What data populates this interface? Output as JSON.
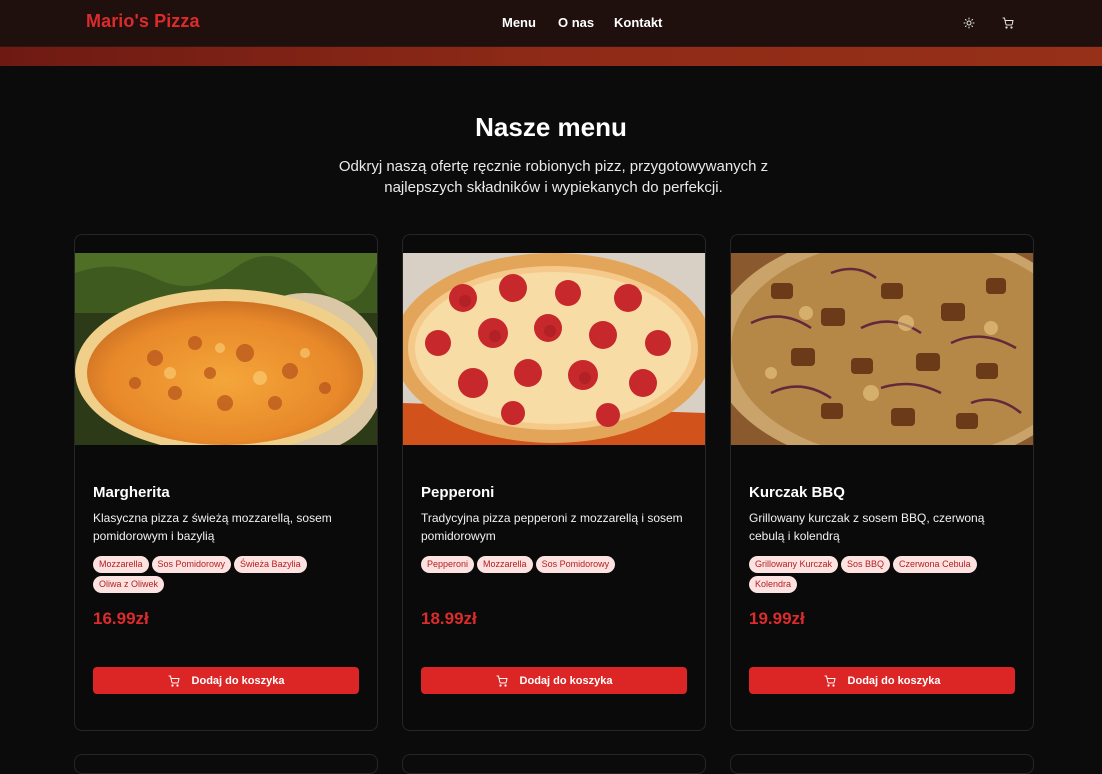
{
  "nav": {
    "brand": "Mario's Pizza",
    "links": [
      "Menu",
      "O nas",
      "Kontakt"
    ],
    "theme_icon": "sun-icon",
    "cart_icon": "cart-icon"
  },
  "hero": {
    "title": "Nasze menu",
    "subtitle": "Odkryj naszą ofertę ręcznie robionych pizz, przygotowywanych z najlepszych składników i wypiekanych do perfekcji."
  },
  "colors": {
    "brand": "#dc2b2b",
    "button": "#dc2626",
    "tag_bg": "#fde2e2",
    "tag_text": "#b3201e"
  },
  "products": [
    {
      "name": "Margherita",
      "description": "Klasyczna pizza z świeżą mozzarellą, sosem pomidorowym i bazylią",
      "tags": [
        "Mozzarella",
        "Sos Pomidorowy",
        "Świeża Bazylia",
        "Oliwa z Oliwek"
      ],
      "price": "16.99zł",
      "button_label": "Dodaj do koszyka",
      "image": "margherita-pizza"
    },
    {
      "name": "Pepperoni",
      "description": "Tradycyjna pizza pepperoni z mozzarellą i sosem pomidorowym",
      "tags": [
        "Pepperoni",
        "Mozzarella",
        "Sos Pomidorowy"
      ],
      "price": "18.99zł",
      "button_label": "Dodaj do koszyka",
      "image": "pepperoni-pizza"
    },
    {
      "name": "Kurczak BBQ",
      "description": "Grillowany kurczak z sosem BBQ, czerwoną cebulą i kolendrą",
      "tags": [
        "Grillowany Kurczak",
        "Sos BBQ",
        "Czerwona Cebula",
        "Kolendra"
      ],
      "price": "19.99zł",
      "button_label": "Dodaj do koszyka",
      "image": "bbq-chicken-pizza"
    }
  ]
}
